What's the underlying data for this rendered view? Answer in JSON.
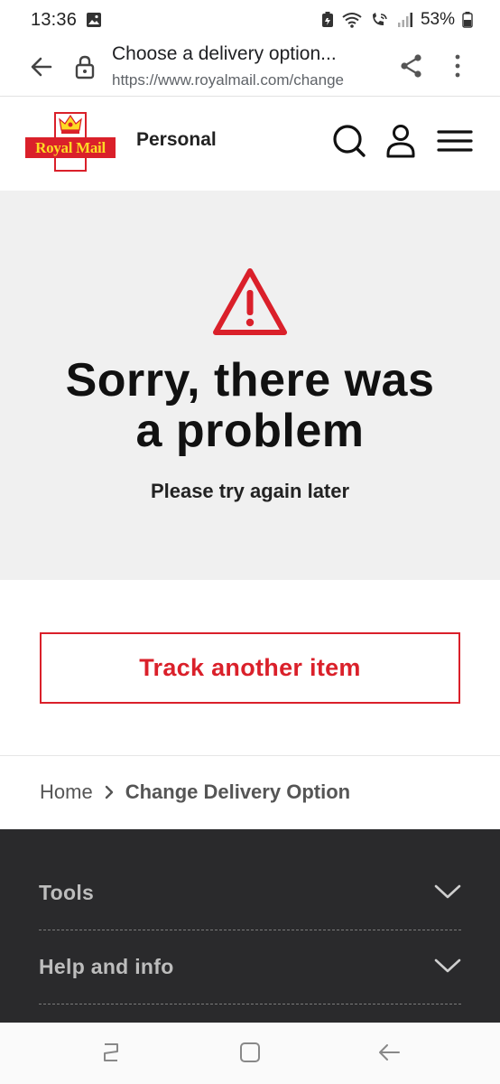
{
  "status_bar": {
    "time": "13:36",
    "battery": "53%"
  },
  "browser": {
    "title": "Choose a delivery option...",
    "url": "https://www.royalmail.com/change"
  },
  "header": {
    "logo_text": "Royal Mail",
    "nav_label": "Personal"
  },
  "error": {
    "title_line1": "Sorry, there was",
    "title_line2": "a problem",
    "subtitle": "Please try again later"
  },
  "actions": {
    "track_label": "Track another item"
  },
  "breadcrumb": {
    "home": "Home",
    "current": "Change Delivery Option"
  },
  "footer": {
    "items": [
      {
        "label": "Tools"
      },
      {
        "label": "Help and info"
      }
    ]
  },
  "colors": {
    "brand_red": "#da202a",
    "brand_yellow": "#fdda24",
    "footer_bg": "#2a2a2c"
  }
}
